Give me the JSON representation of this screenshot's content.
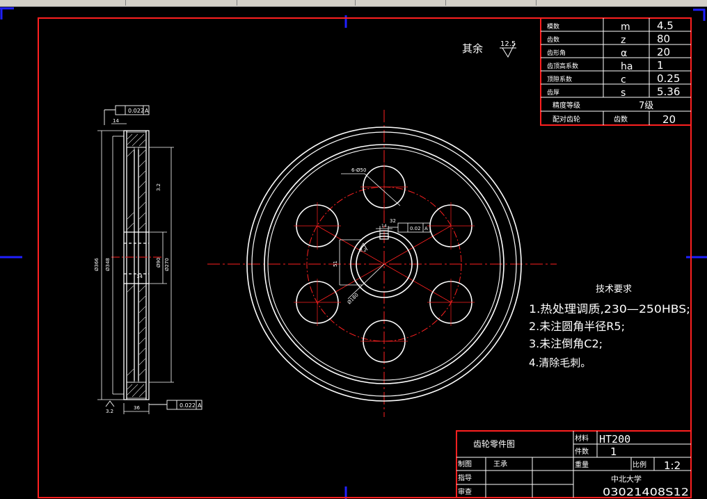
{
  "surface_finish": {
    "label": "其余",
    "value": "12.5"
  },
  "gear_params": {
    "rows": [
      {
        "name": "模数",
        "symbol": "m",
        "value": "4.5"
      },
      {
        "name": "齿数",
        "symbol": "z",
        "value": "80"
      },
      {
        "name": "齿形角",
        "symbol": "α",
        "value": "20"
      },
      {
        "name": "齿顶高系数",
        "symbol": "ha",
        "value": "1"
      },
      {
        "name": "顶隙系数",
        "symbol": "c",
        "value": "0.25"
      },
      {
        "name": "齿厚",
        "symbol": "s",
        "value": "5.36"
      }
    ],
    "precision_label": "精度等级",
    "precision_value": "7级",
    "mating_label": "配对齿轮",
    "mating_sub": "齿数",
    "mating_value": "20"
  },
  "tech_requirements": {
    "title": "技术要求",
    "items": [
      "1.热处理调质,230—250HBS;",
      "2.未注圆角半径R5;",
      "3.未注倒角C2;",
      "4.清除毛刺。"
    ]
  },
  "side_view": {
    "runout_top": "0.022",
    "runout_bottom": "0.022",
    "datum": "A",
    "dim_14_top": "14",
    "dim_14_mid": "14",
    "dim_36": "36",
    "roughness_left": "3.2",
    "dia_outer": "Ø366",
    "dia_root": "Ø348",
    "dia_hub": "Ø90",
    "dia_rim": "Ø270",
    "roughness_side": "3.2"
  },
  "front_view": {
    "holes_label": "6-Ø50",
    "keyway_tol": "0.02",
    "keyway_datum": "A",
    "key_width": "32",
    "dim_51": "51",
    "dim_circle": "Ø180",
    "dim_small": "14",
    "dim_hub_label": "3.2"
  },
  "title_block": {
    "drawing_name": "齿轮零件图",
    "material_label": "材料",
    "material_value": "HT200",
    "count_label": "件数",
    "count_value": "1",
    "weight_label": "重量",
    "scale_label": "比例",
    "scale_value": "1:2",
    "drawn_label": "制图",
    "drawn_by": "王承",
    "guide_label": "指导",
    "review_label": "审查",
    "school": "中北大学",
    "code": "03021408S12"
  },
  "colors": {
    "border": "#ff2020",
    "lines": "#ffffff",
    "center": "#ff2020",
    "axis": "#2020ff"
  }
}
